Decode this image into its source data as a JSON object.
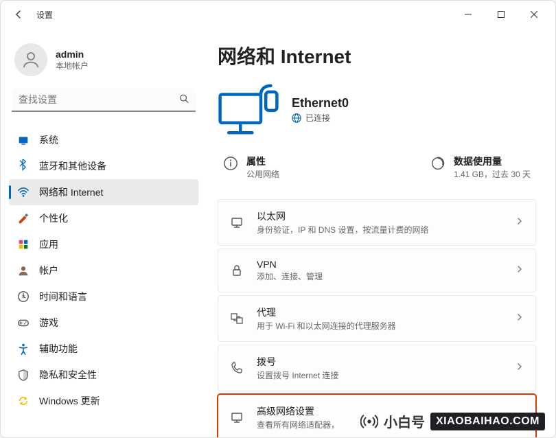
{
  "window": {
    "title": "设置"
  },
  "user": {
    "name": "admin",
    "type": "本地帐户"
  },
  "search": {
    "placeholder": "查找设置"
  },
  "nav": [
    {
      "label": "系统",
      "icon": "system"
    },
    {
      "label": "蓝牙和其他设备",
      "icon": "bluetooth"
    },
    {
      "label": "网络和 Internet",
      "icon": "wifi",
      "active": true
    },
    {
      "label": "个性化",
      "icon": "personalize"
    },
    {
      "label": "应用",
      "icon": "apps"
    },
    {
      "label": "帐户",
      "icon": "account"
    },
    {
      "label": "时间和语言",
      "icon": "time"
    },
    {
      "label": "游戏",
      "icon": "games"
    },
    {
      "label": "辅助功能",
      "icon": "accessibility"
    },
    {
      "label": "隐私和安全性",
      "icon": "privacy"
    },
    {
      "label": "Windows 更新",
      "icon": "update"
    }
  ],
  "page": {
    "title": "网络和 Internet",
    "connection": {
      "name": "Ethernet0",
      "status": "已连接"
    },
    "properties": {
      "title": "属性",
      "sub": "公用网络"
    },
    "usage": {
      "title": "数据使用量",
      "sub": "1.41 GB，过去 30 天"
    },
    "cards": [
      {
        "key": "ethernet",
        "title": "以太网",
        "sub": "身份验证，IP 和 DNS 设置，按流量计费的网络"
      },
      {
        "key": "vpn",
        "title": "VPN",
        "sub": "添加、连接、管理"
      },
      {
        "key": "proxy",
        "title": "代理",
        "sub": "用于 Wi-Fi 和以太网连接的代理服务器"
      },
      {
        "key": "dialup",
        "title": "拨号",
        "sub": "设置拨号 Internet 连接"
      },
      {
        "key": "advanced",
        "title": "高级网络设置",
        "sub": "查看所有网络适配器，",
        "highlighted": true
      }
    ]
  },
  "watermark": {
    "cn": "小白号",
    "en": "XIAOBAIHAO.COM"
  }
}
